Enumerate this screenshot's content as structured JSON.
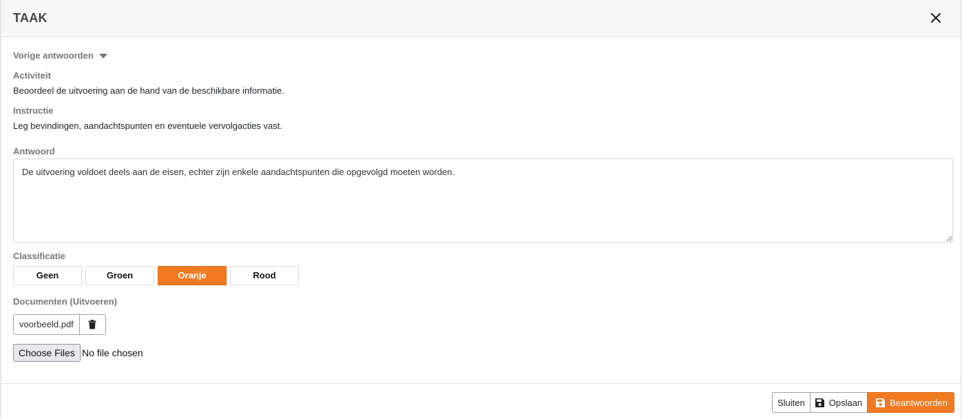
{
  "header": {
    "title": "TAAK"
  },
  "previous": {
    "label": "Vorige antwoorden"
  },
  "activity": {
    "label": "Activiteit",
    "text": "Beoordeel de uitvoering aan de hand van de beschikbare informatie."
  },
  "instruction": {
    "label": "Instructie",
    "text": "Leg bevindingen, aandachtspunten en eventuele vervolgacties vast."
  },
  "answer": {
    "label": "Antwoord",
    "value": "De uitvoering voldoet deels aan de eisen, echter zijn enkele aandachtspunten die opgevolgd moeten worden."
  },
  "classification": {
    "label": "Classificatie",
    "options": [
      "Geen",
      "Groen",
      "Oranje",
      "Rood"
    ],
    "selected": "Oranje"
  },
  "documents": {
    "label": "Documenten (Uitvoeren)",
    "files": [
      "voorbeeld.pdf"
    ],
    "choose_label": "Choose Files",
    "no_file_text": "No file chosen"
  },
  "footer": {
    "close_label": "Sluiten",
    "save_label": "Opslaan",
    "submit_label": "Beantwoorden"
  },
  "colors": {
    "accent": "#f07a22",
    "header_bg": "#f7f7f8",
    "label": "#777777"
  },
  "icons": {
    "close": "close-icon",
    "caret": "caret-down-icon",
    "trash": "trash-icon",
    "save": "save-icon"
  }
}
